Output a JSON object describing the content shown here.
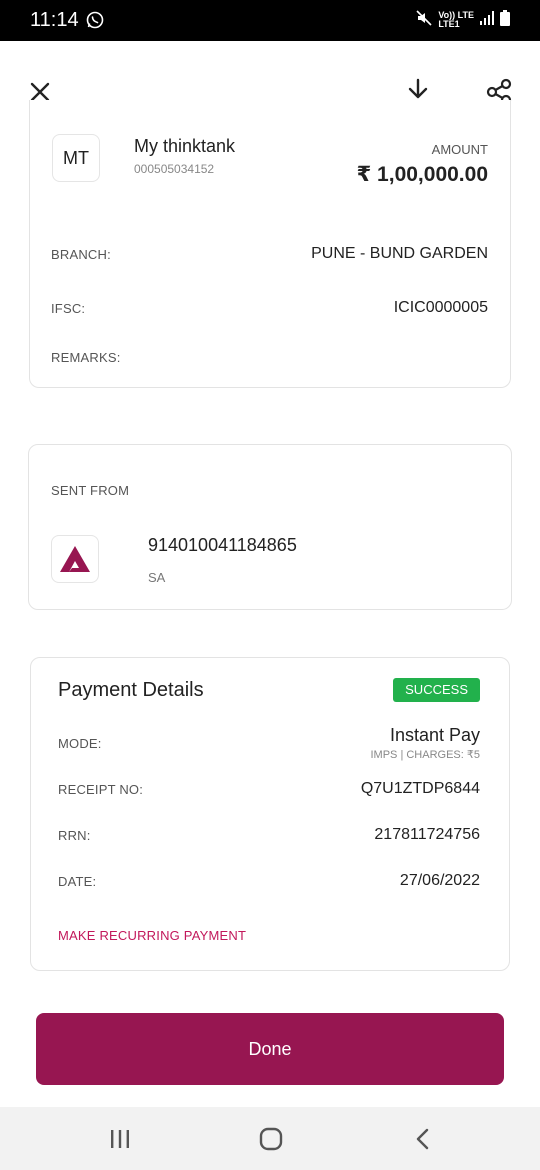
{
  "status_bar": {
    "time": "11:14",
    "network_top": "Vo)) LTE",
    "network_bottom": "LTE1"
  },
  "icons": {
    "close": "close-icon",
    "download": "download-icon",
    "share": "share-icon"
  },
  "beneficiary": {
    "initials": "MT",
    "name": "My thinktank",
    "account": "000505034152",
    "amount_label": "AMOUNT",
    "amount": "₹ 1,00,000.00",
    "branch_label": "BRANCH:",
    "branch": "PUNE - BUND GARDEN",
    "ifsc_label": "IFSC:",
    "ifsc": "ICIC0000005",
    "remarks_label": "REMARKS:"
  },
  "sent_from": {
    "label": "SENT FROM",
    "account": "914010041184865",
    "type": "SA"
  },
  "payment": {
    "title": "Payment Details",
    "status": "SUCCESS",
    "mode_label": "MODE:",
    "mode": "Instant Pay",
    "mode_sub": "IMPS | CHARGES: ₹5",
    "receipt_label": "RECEIPT NO:",
    "receipt": "Q7U1ZTDP6844",
    "rrn_label": "RRN:",
    "rrn": "217811724756",
    "date_label": "DATE:",
    "date": "27/06/2022",
    "recurring_link": "MAKE RECURRING PAYMENT"
  },
  "done_label": "Done",
  "colors": {
    "brand": "#971651",
    "success": "#22b14c",
    "link": "#c2185b"
  }
}
